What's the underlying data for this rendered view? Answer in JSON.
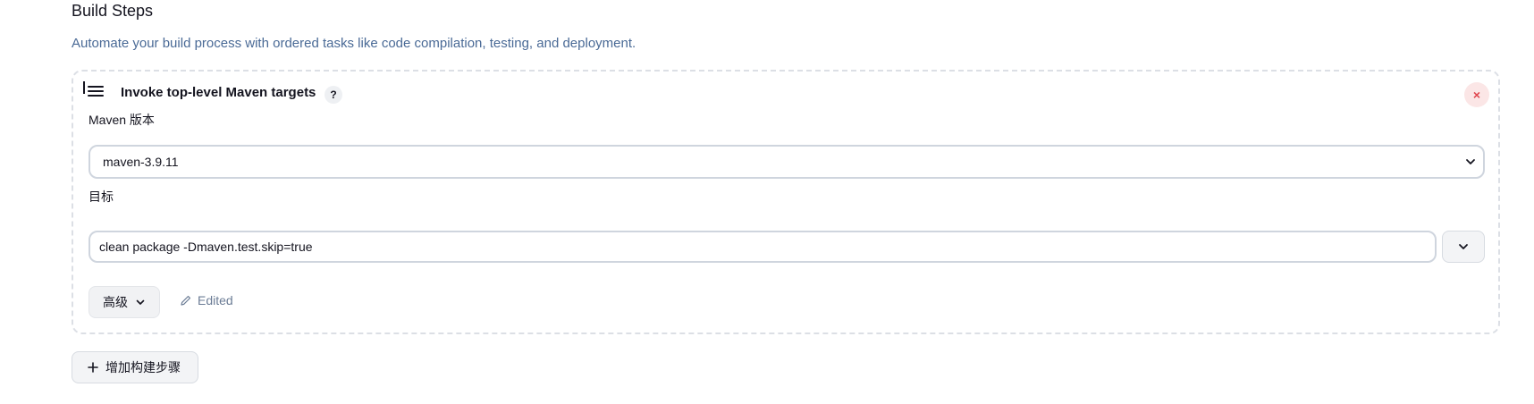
{
  "section": {
    "title": "Build Steps",
    "description": "Automate your build process with ordered tasks like code compilation, testing, and deployment."
  },
  "step": {
    "title": "Invoke top-level Maven targets",
    "help_label": "?",
    "close_label": "×",
    "maven_version_label": "Maven 版本",
    "maven_version_value": "maven-3.9.11",
    "goals_label": "目标",
    "goals_value": "clean package -Dmaven.test.skip=true",
    "advanced_label": "高级",
    "edited_label": "Edited"
  },
  "add_step": {
    "label": "增加构建步骤"
  },
  "icons": {
    "drag": "drag-handle-icon",
    "close": "close-icon",
    "chevron": "chevron-down-icon",
    "pencil": "pencil-icon",
    "plus": "plus-icon"
  },
  "colors": {
    "description": "#4a6a96",
    "close_bg": "#fbe6e6",
    "close_fg": "#e0454d",
    "edited": "#6b7c95"
  }
}
